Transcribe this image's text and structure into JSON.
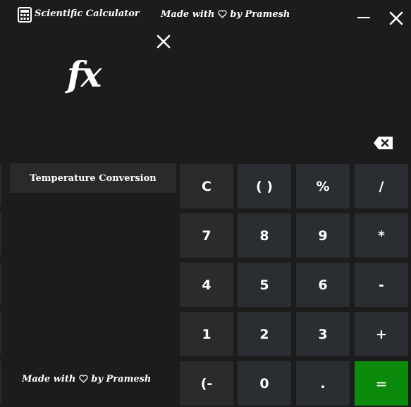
{
  "titlebar": {
    "app_title": "Scientific Calculator",
    "credit_prefix": "Made with",
    "credit_suffix": "by Pramesh"
  },
  "display": {
    "fx_label": "fx"
  },
  "side_panel": {
    "temperature_button": "Temperature Conversion",
    "credit_prefix": "Made with",
    "credit_suffix": "by Pramesh"
  },
  "keypad": {
    "clear": "C",
    "parens": "( )",
    "percent": "%",
    "divide": "/",
    "seven": "7",
    "eight": "8",
    "nine": "9",
    "multiply": "*",
    "four": "4",
    "five": "5",
    "six": "6",
    "minus": "-",
    "one": "1",
    "two": "2",
    "three": "3",
    "plus": "+",
    "negate": "(-",
    "zero": "0",
    "decimal": ".",
    "equals": "="
  },
  "colors": {
    "background": "#1c1c1c",
    "key": "#2a2d31",
    "equals": "#0b8a0b"
  }
}
